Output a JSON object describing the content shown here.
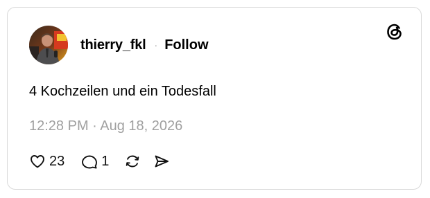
{
  "post": {
    "username": "thierry_fkl",
    "separator": "·",
    "follow_label": "Follow",
    "text": "4 Kochzeilen und ein Todesfall",
    "timestamp": "12:28 PM · Aug 18, 2026"
  },
  "actions": {
    "like_count": "23",
    "reply_count": "1"
  },
  "icons": {
    "logo": "threads-logo-icon",
    "like": "heart-icon",
    "reply": "comment-bubble-icon",
    "repost": "repost-icon",
    "share": "send-icon"
  },
  "colors": {
    "text": "#000000",
    "muted": "#a0a0a0",
    "border": "#d9d9d9"
  }
}
